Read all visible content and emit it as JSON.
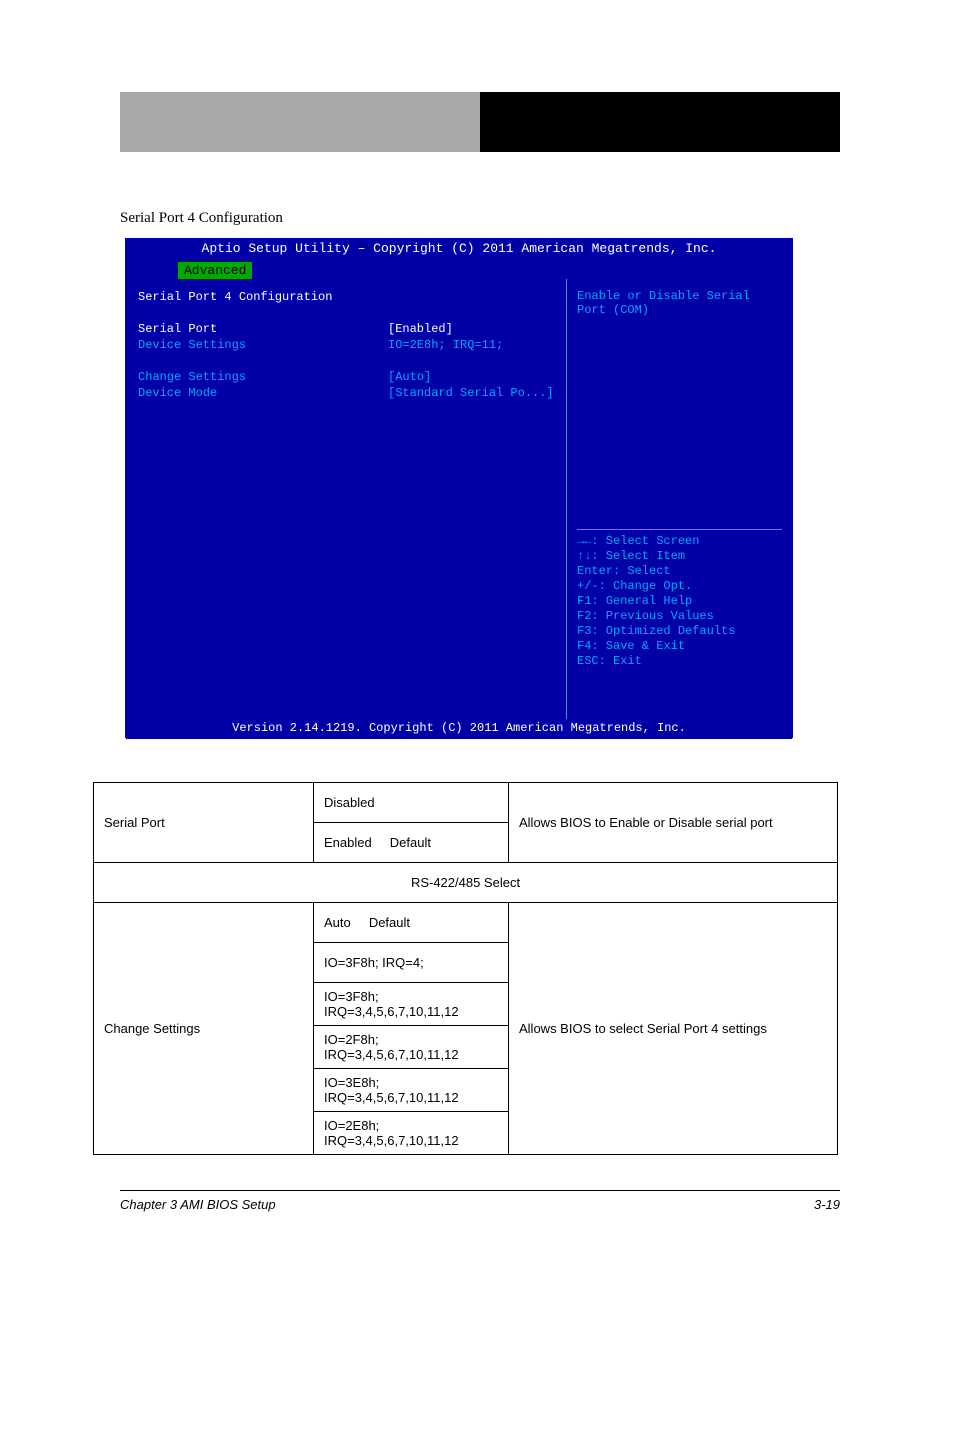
{
  "section_title": "Serial Port 4 Configuration",
  "bios": {
    "title": "Aptio Setup Utility – Copyright (C) 2011 American Megatrends, Inc.",
    "tab": "Advanced",
    "screen_name": "Serial Port 4 Configuration",
    "rows": [
      {
        "label": "Serial Port",
        "value": "[Enabled]"
      },
      {
        "label": "Device Settings",
        "value": "IO=2E8h; IRQ=11;"
      },
      {
        "label": "",
        "value": ""
      },
      {
        "label": "Change Settings",
        "value": "[Auto]"
      },
      {
        "label": "Device Mode",
        "value": "[Standard Serial Po...]"
      }
    ],
    "help_desc": "Enable or Disable Serial Port (COM)",
    "help": [
      "→←: Select Screen",
      "↑↓: Select Item",
      "Enter: Select",
      "+/-: Change Opt.",
      "F1: General Help",
      "F2: Previous Values",
      "F3: Optimized Defaults",
      "F4: Save & Exit",
      "ESC: Exit"
    ],
    "footer": "Version 2.14.1219. Copyright (C) 2011 American Megatrends, Inc."
  },
  "table": {
    "r1": {
      "label": "Serial Port",
      "opt1": "Disabled",
      "opt2": "Enabled",
      "note1": "Default",
      "desc": "Allows BIOS to Enable or Disable serial port"
    },
    "subhead": "RS-422/485 Select",
    "r2": {
      "label": "Change Settings",
      "opts": [
        "Auto",
        "IO=3F8h; IRQ=4;",
        "IO=3F8h; IRQ=3,4,5,6,7,10,11,12",
        "IO=2F8h; IRQ=3,4,5,6,7,10,11,12",
        "IO=3E8h; IRQ=3,4,5,6,7,10,11,12",
        "IO=2E8h; IRQ=3,4,5,6,7,10,11,12"
      ],
      "note": "Default",
      "desc": "Allows BIOS to select Serial Port 4 settings"
    }
  },
  "footer": {
    "left": "Chapter 3 AMI BIOS Setup",
    "right": "3-19"
  }
}
